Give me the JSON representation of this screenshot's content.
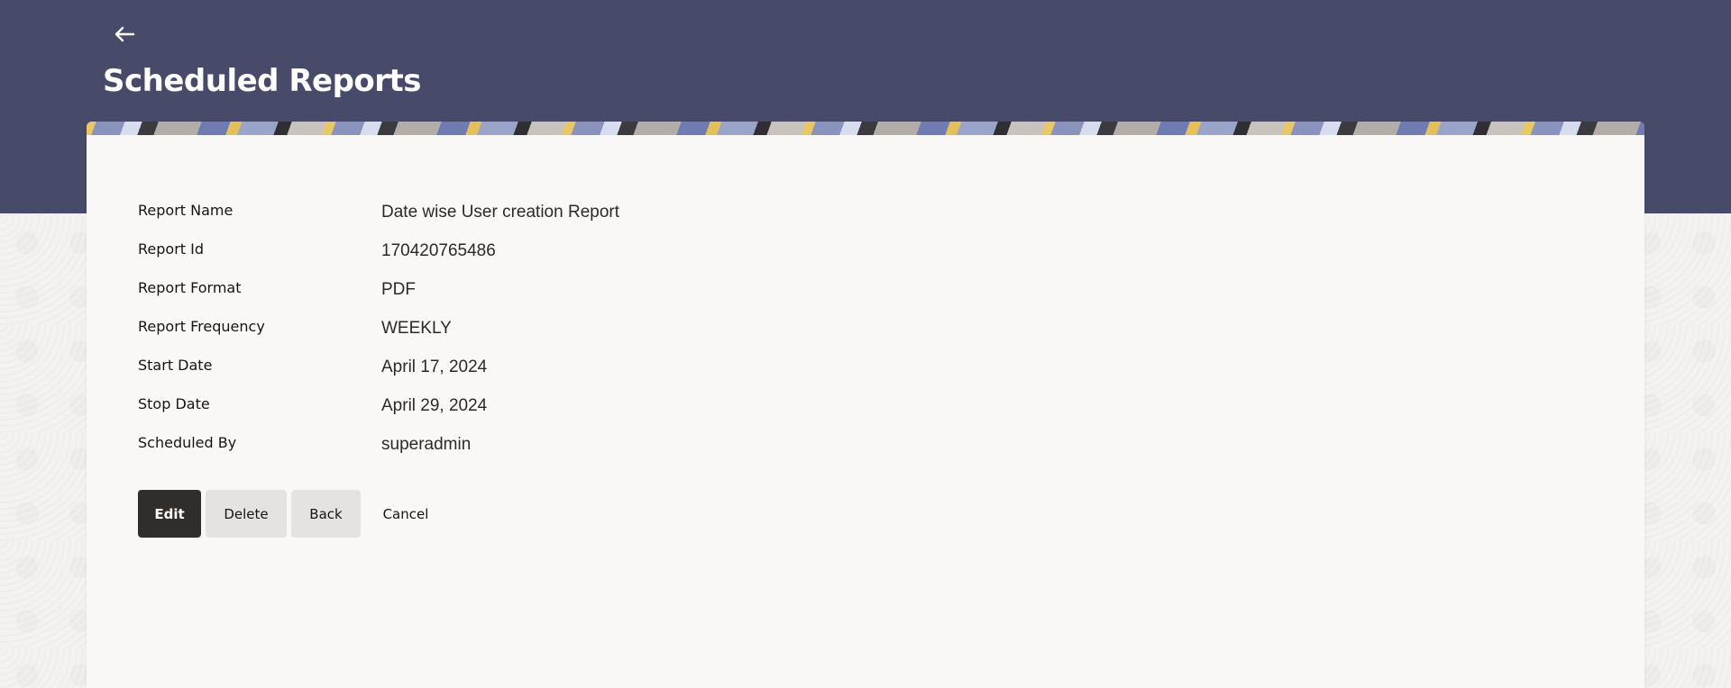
{
  "header": {
    "back_icon": "back-arrow-icon",
    "title": "Scheduled Reports"
  },
  "details": {
    "rows": [
      {
        "label": "Report Name",
        "value": "Date wise User creation Report"
      },
      {
        "label": "Report Id",
        "value": "170420765486"
      },
      {
        "label": "Report Format",
        "value": "PDF"
      },
      {
        "label": "Report Frequency",
        "value": "WEEKLY"
      },
      {
        "label": "Start Date",
        "value": "April 17, 2024"
      },
      {
        "label": "Stop Date",
        "value": "April 29, 2024"
      },
      {
        "label": "Scheduled By",
        "value": "superadmin"
      }
    ]
  },
  "actions": {
    "edit_label": "Edit",
    "delete_label": "Delete",
    "back_label": "Back",
    "cancel_label": "Cancel"
  },
  "colors": {
    "header_bg": "#474b69",
    "primary_button": "#312d2a",
    "secondary_button": "#e4e3e1",
    "card_bg": "#f9f8f6"
  }
}
